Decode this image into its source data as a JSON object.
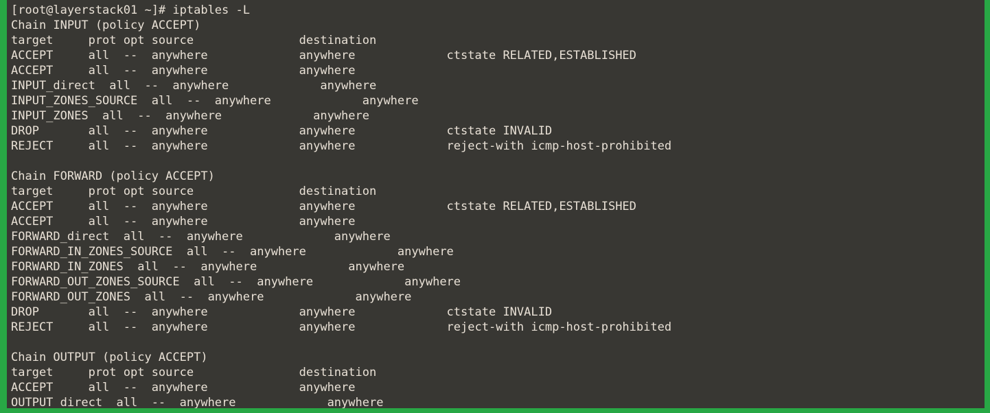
{
  "terminal": {
    "prompt": "[root@layerstack01 ~]#",
    "command": "iptables -L",
    "colors": {
      "background": "#383733",
      "foreground": "#e9e1d6",
      "accent_green": "#28a745"
    },
    "lines": [
      "[root@layerstack01 ~]# iptables -L",
      "Chain INPUT (policy ACCEPT)",
      "target     prot opt source               destination         ",
      "ACCEPT     all  --  anywhere             anywhere             ctstate RELATED,ESTABLISHED",
      "ACCEPT     all  --  anywhere             anywhere            ",
      "INPUT_direct  all  --  anywhere             anywhere            ",
      "INPUT_ZONES_SOURCE  all  --  anywhere             anywhere            ",
      "INPUT_ZONES  all  --  anywhere             anywhere            ",
      "DROP       all  --  anywhere             anywhere             ctstate INVALID",
      "REJECT     all  --  anywhere             anywhere             reject-with icmp-host-prohibited",
      "",
      "Chain FORWARD (policy ACCEPT)",
      "target     prot opt source               destination         ",
      "ACCEPT     all  --  anywhere             anywhere             ctstate RELATED,ESTABLISHED",
      "ACCEPT     all  --  anywhere             anywhere            ",
      "FORWARD_direct  all  --  anywhere             anywhere            ",
      "FORWARD_IN_ZONES_SOURCE  all  --  anywhere             anywhere            ",
      "FORWARD_IN_ZONES  all  --  anywhere             anywhere            ",
      "FORWARD_OUT_ZONES_SOURCE  all  --  anywhere             anywhere            ",
      "FORWARD_OUT_ZONES  all  --  anywhere             anywhere            ",
      "DROP       all  --  anywhere             anywhere             ctstate INVALID",
      "REJECT     all  --  anywhere             anywhere             reject-with icmp-host-prohibited",
      "",
      "Chain OUTPUT (policy ACCEPT)",
      "target     prot opt source               destination         ",
      "ACCEPT     all  --  anywhere             anywhere            ",
      "OUTPUT_direct  all  --  anywhere             anywhere            "
    ]
  }
}
